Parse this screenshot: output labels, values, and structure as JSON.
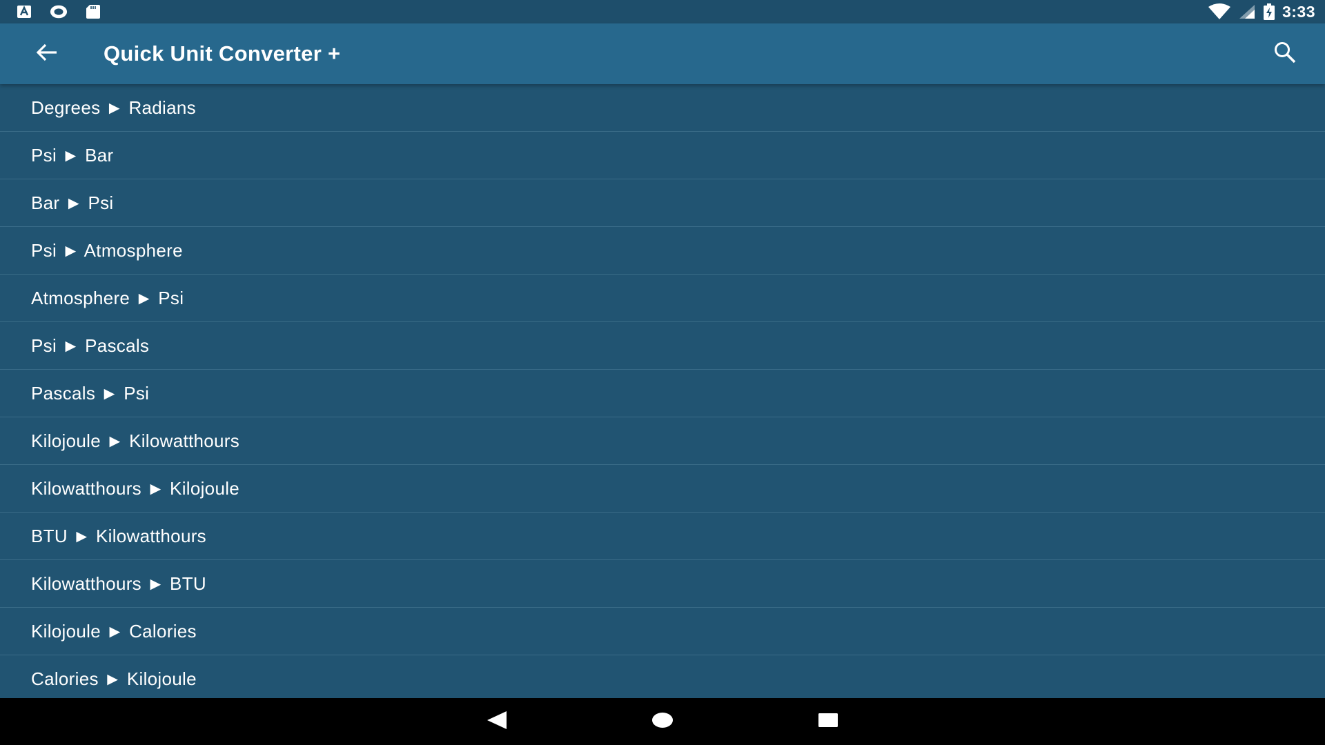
{
  "status_bar": {
    "time": "3:33",
    "icons_left": [
      "text-notification-icon",
      "circle-notification-icon",
      "sd-card-icon"
    ],
    "icons_right": [
      "wifi-icon",
      "cell-signal-icon",
      "battery-charging-icon"
    ]
  },
  "app_bar": {
    "title": "Quick Unit Converter +",
    "back_icon": "arrow-left-icon",
    "search_icon": "search-icon"
  },
  "conversions": [
    "Degrees ► Radians",
    "Psi ► Bar",
    "Bar ► Psi",
    "Psi ► Atmosphere",
    "Atmosphere ► Psi",
    "Psi ► Pascals",
    "Pascals ► Psi",
    "Kilojoule ► Kilowatthours",
    "Kilowatthours ► Kilojoule",
    "BTU ► Kilowatthours",
    "Kilowatthours ► BTU",
    "Kilojoule ► Calories",
    "Calories ► Kilojoule"
  ],
  "nav_bar": {
    "back_icon": "nav-back-icon",
    "home_icon": "nav-home-icon",
    "recents_icon": "nav-recents-icon"
  },
  "colors": {
    "background": "#215472",
    "app_bar": "#27688d",
    "status_bar": "#1e4e6b",
    "divider": "#3a6c88",
    "text": "#ffffff"
  }
}
